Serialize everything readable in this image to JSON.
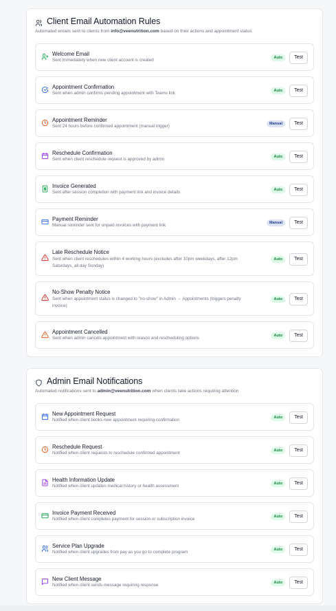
{
  "client_section": {
    "title": "Client Email Automation Rules",
    "subtitle_pre": "Automated emails sent to clients from ",
    "subtitle_email": "info@veenutrition.com",
    "subtitle_post": " based on their actions and appointment status",
    "rules": [
      {
        "name": "Welcome Email",
        "desc": "Sent immediately when new client account is created",
        "mode": "Auto",
        "icon": "user-plus-icon",
        "color": "#16a34a"
      },
      {
        "name": "Appointment Confirmation",
        "desc": "Sent when admin confirms pending appointment with Teams link",
        "mode": "Auto",
        "icon": "check-circle-icon",
        "color": "#2563eb"
      },
      {
        "name": "Appointment Reminder",
        "desc": "Sent 24 hours before confirmed appointment (manual trigger)",
        "mode": "Manual",
        "icon": "clock-icon",
        "color": "#ea580c"
      },
      {
        "name": "Reschedule Confirmation",
        "desc": "Sent when client reschedule request is approved by admin",
        "mode": "Auto",
        "icon": "calendar-icon",
        "color": "#9333ea"
      },
      {
        "name": "Invoice Generated",
        "desc": "Sent after session completion with payment link and invoice details",
        "mode": "Auto",
        "icon": "dollar-icon",
        "color": "#16a34a"
      },
      {
        "name": "Payment Reminder",
        "desc": "Manual reminder sent for unpaid invoices with payment link",
        "mode": "Manual",
        "icon": "credit-card-icon",
        "color": "#2563eb"
      },
      {
        "name": "Late Reschedule Notice",
        "desc": "Sent when client reschedules within 4 working hours (excludes after 10pm weekdays, after 12pm Saturdays, all day Sunday)",
        "mode": "Auto",
        "icon": "warning-icon",
        "color": "#dc2626"
      },
      {
        "name": "No-Show Penalty Notice",
        "desc": "Sent when appointment status is changed to \"no-show\" in Admin → Appointments (triggers penalty invoice)",
        "mode": "Auto",
        "icon": "alert-circle-icon",
        "color": "#dc2626"
      },
      {
        "name": "Appointment Cancelled",
        "desc": "Sent when admin cancels appointment with reason and rescheduling options",
        "mode": "Auto",
        "icon": "warning-icon",
        "color": "#ea580c"
      }
    ]
  },
  "admin_section": {
    "title": "Admin Email Notifications",
    "subtitle_pre": "Automated notifications sent to ",
    "subtitle_email": "admin@veenutrition.com",
    "subtitle_post": " when clients take actions requiring attention",
    "rules": [
      {
        "name": "New Appointment Request",
        "desc": "Notified when client books new appointment requiring confirmation",
        "mode": "Auto",
        "icon": "calendar-icon",
        "color": "#2563eb"
      },
      {
        "name": "Reschedule Request",
        "desc": "Notified when client requests to reschedule confirmed appointment",
        "mode": "Auto",
        "icon": "clock-icon",
        "color": "#ea580c"
      },
      {
        "name": "Health Information Update",
        "desc": "Notified when client updates medical history or health assessment",
        "mode": "Auto",
        "icon": "file-icon",
        "color": "#9333ea"
      },
      {
        "name": "Invoice Payment Received",
        "desc": "Notified when client completes payment for session or subscription invoice",
        "mode": "Auto",
        "icon": "credit-card-icon",
        "color": "#16a34a"
      },
      {
        "name": "Service Plan Upgrade",
        "desc": "Notified when client upgrades from pay as you go to complete program",
        "mode": "Auto",
        "icon": "users-icon",
        "color": "#2563eb"
      },
      {
        "name": "New Client Message",
        "desc": "Notified when client sends message requiring response",
        "mode": "Auto",
        "icon": "message-icon",
        "color": "#9333ea"
      }
    ]
  },
  "test_label": "Test"
}
